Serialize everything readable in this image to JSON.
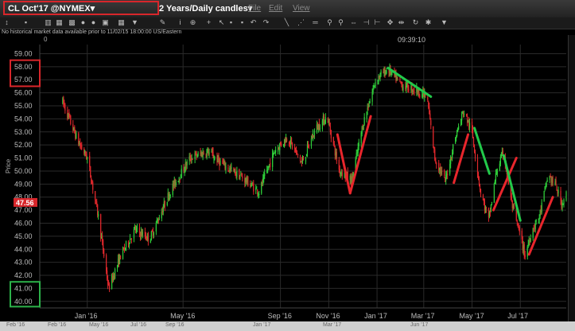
{
  "window": {
    "symbol_title": "CL Oct'17 @NYMEX▾",
    "period_title": "2 Years",
    "interval_title": "/Daily candles▾",
    "menus": [
      "File",
      "Edit",
      "View"
    ]
  },
  "notice": "No historical market data available prior to 11/02/15 18:00:00 US/Eastern",
  "chart_header_marker": "0",
  "clock": "09:39:10",
  "axis_title": "Price",
  "last_price": "47.56",
  "bottom_labels": [
    "Feb '16",
    "Feb '16",
    "May '16",
    "Jul '16",
    "Sep '16",
    "Jan '17",
    "Mar '17",
    "Jun '17"
  ],
  "colors": {
    "up": "#2fcf3a",
    "down": "#e0282c",
    "annotation_red": "#e8262c",
    "annotation_green": "#22c94a",
    "box_red": "#d8262b",
    "box_green": "#2cb24a",
    "price_tag": "#d8262b"
  },
  "chart_data": {
    "type": "candlestick",
    "y_ticks": [
      59,
      58,
      57,
      56,
      55,
      54,
      53,
      52,
      51,
      50,
      49,
      48,
      47,
      46,
      45,
      44,
      43,
      42,
      41,
      40
    ],
    "ylim": [
      39.5,
      59.7
    ],
    "x_ticks": [
      {
        "label": "Jan '16",
        "date": "2016-01-01"
      },
      {
        "label": "May '16",
        "date": "2016-05-01"
      },
      {
        "label": "Sep '16",
        "date": "2016-09-01"
      },
      {
        "label": "Nov '16",
        "date": "2016-11-01"
      },
      {
        "label": "Jan '17",
        "date": "2017-01-01"
      },
      {
        "label": "Mar '17",
        "date": "2017-03-01"
      },
      {
        "label": "May '17",
        "date": "2017-05-01"
      },
      {
        "label": "Jul '17",
        "date": "2017-07-01"
      }
    ],
    "xlim": [
      "2015-11-02",
      "2017-08-28"
    ],
    "price_path": [
      [
        "2015-12-01",
        55.3
      ],
      [
        "2015-12-20",
        52.3
      ],
      [
        "2016-01-01",
        51.0
      ],
      [
        "2016-01-15",
        46.5
      ],
      [
        "2016-01-28",
        41.0
      ],
      [
        "2016-02-12",
        43.5
      ],
      [
        "2016-03-01",
        45.5
      ],
      [
        "2016-03-20",
        44.8
      ],
      [
        "2016-04-15",
        48.5
      ],
      [
        "2016-05-10",
        51.0
      ],
      [
        "2016-06-01",
        51.5
      ],
      [
        "2016-06-20",
        50.5
      ],
      [
        "2016-07-15",
        49.5
      ],
      [
        "2016-08-05",
        48.4
      ],
      [
        "2016-08-25",
        51.6
      ],
      [
        "2016-09-10",
        52.6
      ],
      [
        "2016-09-28",
        50.6
      ],
      [
        "2016-10-15",
        53.2
      ],
      [
        "2016-10-30",
        54.2
      ],
      [
        "2016-11-14",
        50.1
      ],
      [
        "2016-11-30",
        49.3
      ],
      [
        "2016-12-15",
        53.8
      ],
      [
        "2016-12-31",
        57.1
      ],
      [
        "2017-01-15",
        57.8
      ],
      [
        "2017-02-01",
        56.6
      ],
      [
        "2017-02-20",
        56.2
      ],
      [
        "2017-03-05",
        55.7
      ],
      [
        "2017-03-15",
        51.0
      ],
      [
        "2017-03-28",
        49.2
      ],
      [
        "2017-04-10",
        52.6
      ],
      [
        "2017-04-20",
        54.6
      ],
      [
        "2017-05-01",
        53.0
      ],
      [
        "2017-05-12",
        48.3
      ],
      [
        "2017-05-22",
        46.2
      ],
      [
        "2017-06-01",
        50.0
      ],
      [
        "2017-06-10",
        51.5
      ],
      [
        "2017-06-20",
        47.5
      ],
      [
        "2017-06-30",
        45.2
      ],
      [
        "2017-07-07",
        43.5
      ],
      [
        "2017-07-15",
        45.4
      ],
      [
        "2017-07-25",
        46.5
      ],
      [
        "2017-08-05",
        49.7
      ],
      [
        "2017-08-15",
        48.8
      ],
      [
        "2017-08-22",
        47.5
      ],
      [
        "2017-08-28",
        48.2
      ]
    ],
    "annotations": [
      {
        "color": "red",
        "from": [
          "2016-11-12",
          52.8
        ],
        "to": [
          "2016-11-28",
          48.3
        ]
      },
      {
        "color": "red",
        "from": [
          "2016-11-28",
          48.3
        ],
        "to": [
          "2016-12-24",
          54.2
        ]
      },
      {
        "color": "green",
        "from": [
          "2017-01-15",
          57.9
        ],
        "to": [
          "2017-03-10",
          55.7
        ]
      },
      {
        "color": "red",
        "from": [
          "2017-04-08",
          49.1
        ],
        "to": [
          "2017-04-26",
          52.8
        ]
      },
      {
        "color": "green",
        "from": [
          "2017-05-04",
          53.3
        ],
        "to": [
          "2017-05-23",
          49.8
        ]
      },
      {
        "color": "red",
        "from": [
          "2017-05-28",
          47.0
        ],
        "to": [
          "2017-06-26",
          51.0
        ]
      },
      {
        "color": "green",
        "from": [
          "2017-06-10",
          51.2
        ],
        "to": [
          "2017-07-01",
          46.2
        ]
      },
      {
        "color": "red",
        "from": [
          "2017-07-12",
          43.6
        ],
        "to": [
          "2017-08-11",
          48.0
        ]
      }
    ],
    "highlight_boxes": [
      {
        "color": "red",
        "y_range": [
          56.5,
          58.5
        ]
      },
      {
        "color": "green",
        "y_range": [
          39.6,
          41.5
        ]
      }
    ]
  }
}
